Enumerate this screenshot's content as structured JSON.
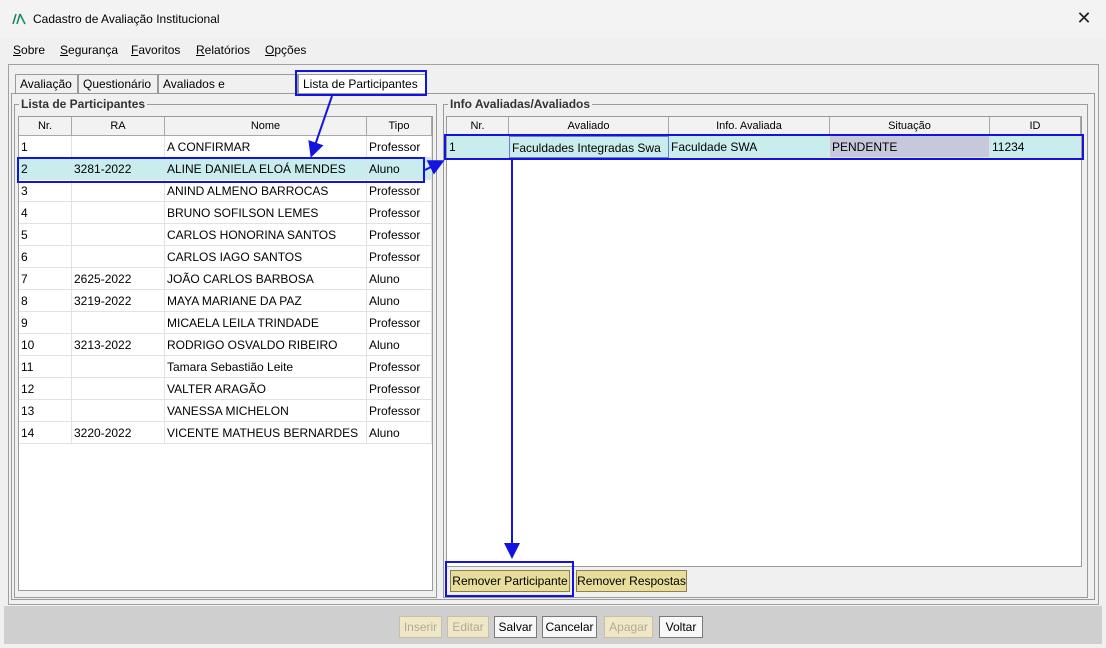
{
  "window": {
    "title": "Cadastro de Avaliação Institucional",
    "close_glyph": "✕"
  },
  "menu": [
    "Sobre",
    "Segurança",
    "Favoritos",
    "Relatórios",
    "Opções"
  ],
  "tabs": [
    "Avaliação",
    "Questionário",
    "Avaliados e Participantes",
    "Lista de Participantes"
  ],
  "active_tab": 3,
  "participants": {
    "title": "Lista de Participantes",
    "columns": [
      "Nr.",
      "RA",
      "Nome",
      "Tipo"
    ],
    "rows": [
      [
        "1",
        "",
        "A CONFIRMAR",
        "Professor"
      ],
      [
        "2",
        "3281-2022",
        "ALINE DANIELA ELOÁ MENDES",
        "Aluno"
      ],
      [
        "3",
        "",
        "ANIND ALMENO BARROCAS",
        "Professor"
      ],
      [
        "4",
        "",
        "BRUNO SOFILSON LEMES",
        "Professor"
      ],
      [
        "5",
        "",
        "CARLOS HONORINA SANTOS",
        "Professor"
      ],
      [
        "6",
        "",
        "CARLOS IAGO SANTOS",
        "Professor"
      ],
      [
        "7",
        "2625-2022",
        "JOÃO CARLOS BARBOSA",
        "Aluno"
      ],
      [
        "8",
        "3219-2022",
        "MAYA MARIANE DA PAZ",
        "Aluno"
      ],
      [
        "9",
        "",
        "MICAELA LEILA TRINDADE",
        "Professor"
      ],
      [
        "10",
        "3213-2022",
        "RODRIGO OSVALDO RIBEIRO",
        "Aluno"
      ],
      [
        "11",
        "",
        "Tamara Sebastião Leite",
        "Professor"
      ],
      [
        "12",
        "",
        "VALTER ARAGÃO",
        "Professor"
      ],
      [
        "13",
        "",
        "VANESSA MICHELON",
        "Professor"
      ],
      [
        "14",
        "3220-2022",
        "VICENTE MATHEUS BERNARDES",
        "Aluno"
      ]
    ],
    "selected_row": 1
  },
  "info": {
    "title": "Info Avaliadas/Avaliados",
    "columns": [
      "Nr.",
      "Avaliado",
      "Info. Avaliada",
      "Situação",
      "ID"
    ],
    "rows": [
      [
        "1",
        "Faculdades Integradas Swa",
        "Faculdade SWA",
        "PENDENTE",
        "11234"
      ]
    ]
  },
  "actions": {
    "remove_participant": "Remover Participante",
    "remove_answers": "Remover Respostas"
  },
  "footer_buttons": [
    {
      "label": "Inserir",
      "enabled": false
    },
    {
      "label": "Editar",
      "enabled": false
    },
    {
      "label": "Salvar",
      "enabled": true
    },
    {
      "label": "Cancelar",
      "enabled": true
    },
    {
      "label": "Apagar",
      "enabled": false
    },
    {
      "label": "Voltar",
      "enabled": true
    }
  ],
  "colors": {
    "highlight": "#1414e0",
    "selected_row": "#c9ecec",
    "status_cell": "#c6c8dc",
    "action_button": "#e8dd9b"
  }
}
